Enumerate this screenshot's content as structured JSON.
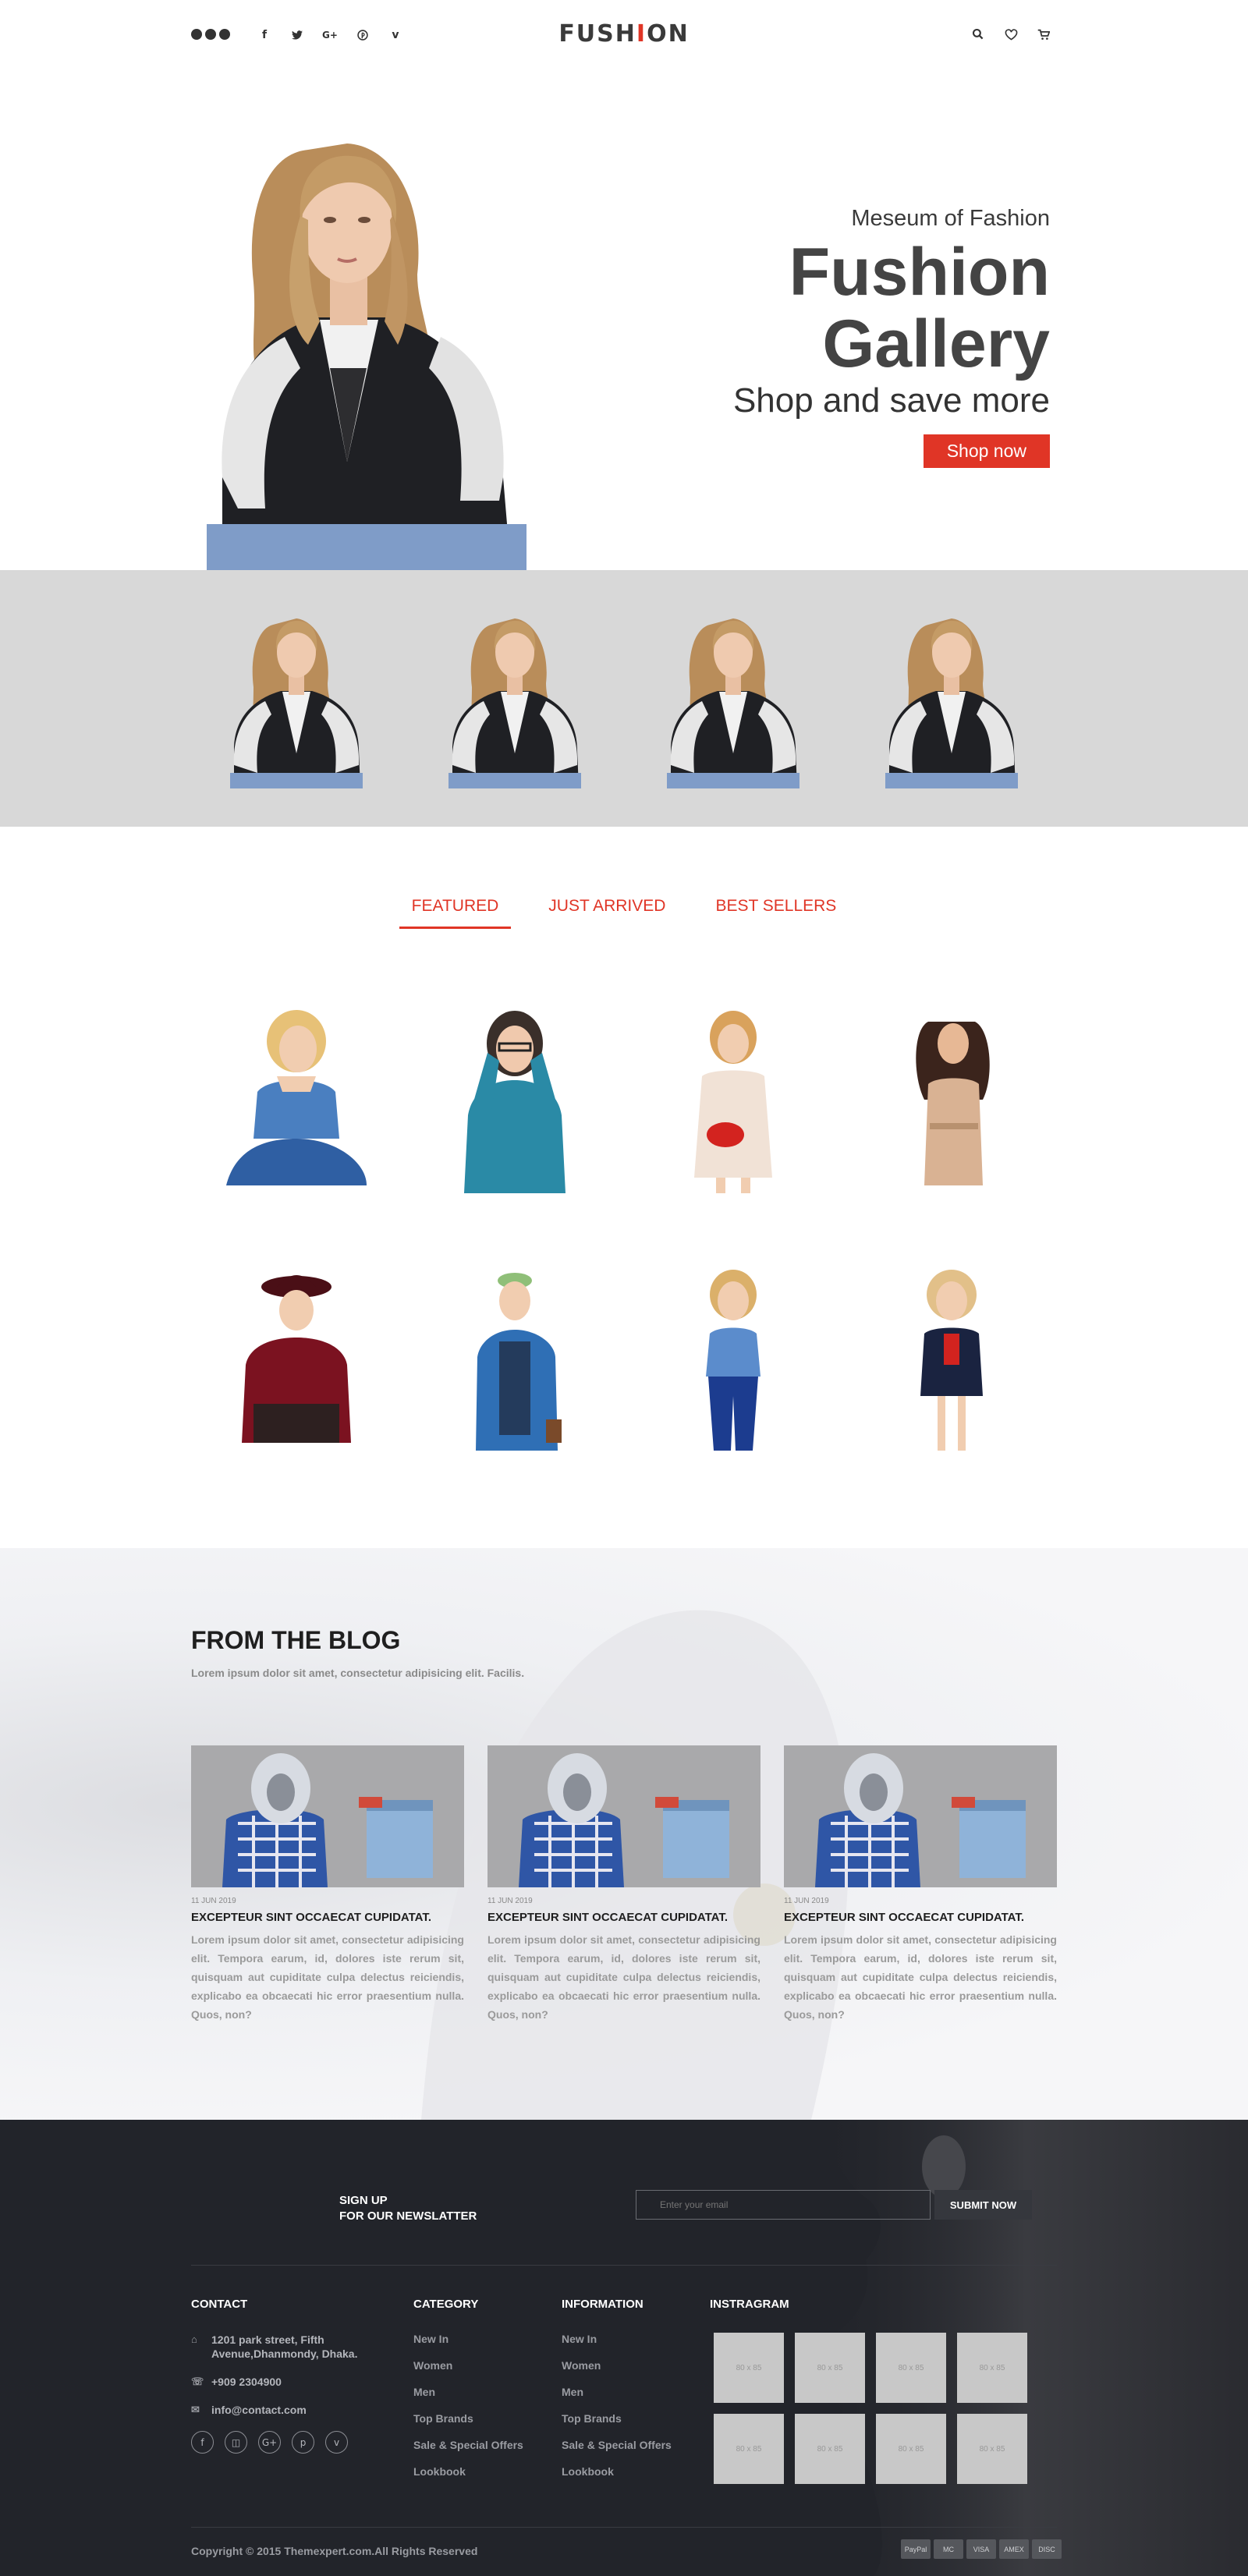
{
  "header": {
    "logo_prefix": "FUSH",
    "logo_accent": "I",
    "logo_suffix": "ON",
    "social_icons": [
      "facebook-icon",
      "twitter-icon",
      "google-plus-icon",
      "pinterest-icon",
      "vimeo-icon"
    ],
    "social_glyphs": [
      "f",
      "t",
      "G+",
      "p",
      "v"
    ]
  },
  "hero": {
    "subtitle": "Meseum of Fashion",
    "title_line1": "Fushion",
    "title_line2": "Gallery",
    "tagline": "Shop and save more",
    "button_label": "Shop now"
  },
  "tabs": [
    "FEATURED",
    "JUST ARRIVED",
    "BEST SELLERS"
  ],
  "blog": {
    "title": "FROM THE BLOG",
    "description": "Lorem ipsum dolor sit amet, consectetur adipisicing elit. Facilis.",
    "posts": [
      {
        "date": "11 JUN 2019",
        "title": "EXCEPTEUR SINT OCCAECAT CUPIDATAT.",
        "body": "Lorem ipsum dolor sit amet, consectetur adipisicing elit. Tempora earum, id, dolores iste rerum sit, quisquam aut cupiditate culpa delectus reiciendis, explicabo ea obcaecati hic error praesentium nulla. Quos, non?"
      },
      {
        "date": "11 JUN 2019",
        "title": "EXCEPTEUR SINT OCCAECAT CUPIDATAT.",
        "body": "Lorem ipsum dolor sit amet, consectetur adipisicing elit. Tempora earum, id, dolores iste rerum sit, quisquam aut cupiditate culpa delectus reiciendis, explicabo ea obcaecati hic error praesentium nulla. Quos, non?"
      },
      {
        "date": "11 JUN 2019",
        "title": "EXCEPTEUR SINT OCCAECAT CUPIDATAT.",
        "body": "Lorem ipsum dolor sit amet, consectetur adipisicing elit. Tempora earum, id, dolores iste rerum sit, quisquam aut cupiditate culpa delectus reiciendis, explicabo ea obcaecati hic error praesentium nulla. Quos, non?"
      }
    ]
  },
  "newsletter": {
    "label_line1": "SIGN UP",
    "label_line2": "FOR OUR NEWSLATTER",
    "placeholder": "Enter your email",
    "button_label": "SUBMIT NOW"
  },
  "footer": {
    "contact": {
      "heading": "CONTACT",
      "address": "1201 park street, Fifth Avenue,Dhanmondy, Dhaka.",
      "phone": "+909 2304900",
      "email": "info@contact.com",
      "social_glyphs": [
        "f",
        "◫",
        "G+",
        "p",
        "v"
      ]
    },
    "category": {
      "heading": "CATEGORY",
      "links": [
        "New In",
        "Women",
        "Men",
        "Top Brands",
        "Sale & Special Offers",
        "Lookbook"
      ]
    },
    "information": {
      "heading": "INFORMATION",
      "links": [
        "New In",
        "Women",
        "Men",
        "Top Brands",
        "Sale & Special Offers",
        "Lookbook"
      ]
    },
    "instagram": {
      "heading": "INSTRAGRAM",
      "thumb_label": "80 x 85"
    },
    "copyright": "Copyright © 2015 Themexpert.com.All Rights Reserved",
    "payment_labels": [
      "PayPal",
      "MC",
      "VISA",
      "AMEX",
      "DISC"
    ]
  },
  "colors": {
    "accent": "#e03526",
    "strip_bg": "#d8d8d8",
    "footer_bg": "#22242a"
  }
}
